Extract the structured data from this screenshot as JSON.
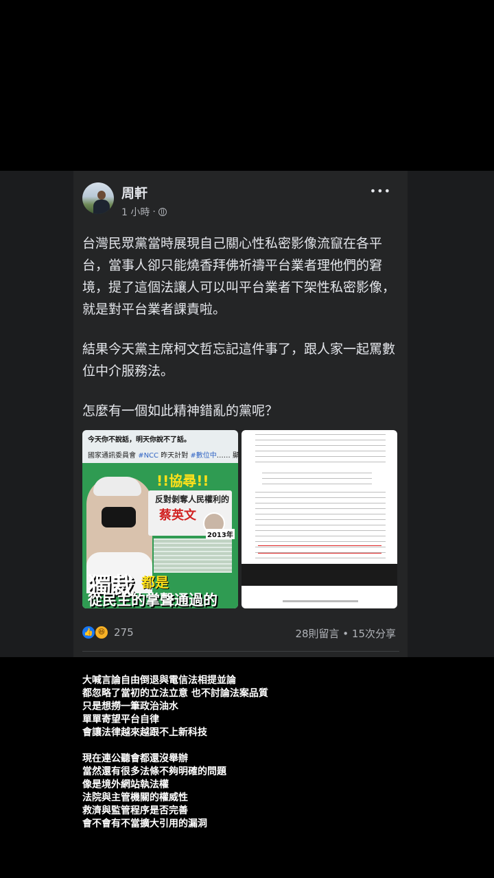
{
  "post": {
    "author": "周軒",
    "time": "1 小時",
    "separator": "·",
    "paragraphs": [
      "台灣民眾黨當時展現自己關心性私密影像流竄在各平台，當事人卻只能燒香拜佛祈禱平台業者理他們的窘境，提了這個法讓人可以叫平台業者下架性私密影像，就是對平台業者課責啦。",
      "結果今天黨主席柯文哲忘記這件事了，跟人家一起罵數位中介服務法。",
      "怎麼有一個如此精神錯亂的黨呢？"
    ],
    "reaction_count": "275",
    "stats": "28則留言 • 15次分享",
    "more_label": "•••"
  },
  "left_image": {
    "top_line": "今天你不說話，明天你說不了話。",
    "line2_prefix": "國家通訊委員會 ",
    "tag1": "#NCC",
    "line2_mid": " 昨天計對 ",
    "tag2": "#數位中",
    "line2_suffix": "…… 顯示更多",
    "alert": "!!協尋!!",
    "subtitle": "反對剝奪人民權利的",
    "name": "蔡英文",
    "year": "2013年",
    "big1": "獨裁",
    "big2": "都是",
    "bottom": "從民主的掌聲通過的"
  },
  "caption": {
    "group1": [
      "大喊言論自由倒退與電信法相提並論",
      "都忽略了當初的立法立意 也不討論法案品質",
      "只是想撈一筆政治油水",
      "單單寄望平台自律",
      "會讓法律越來越跟不上新科技"
    ],
    "group2": [
      "現在連公聽會都還沒舉辦",
      "當然還有很多法條不夠明確的問題",
      "像是境外網站執法權",
      "法院與主管機關的權威性",
      "救濟與監管程序是否完善",
      "會不會有不當擴大引用的漏洞"
    ]
  }
}
